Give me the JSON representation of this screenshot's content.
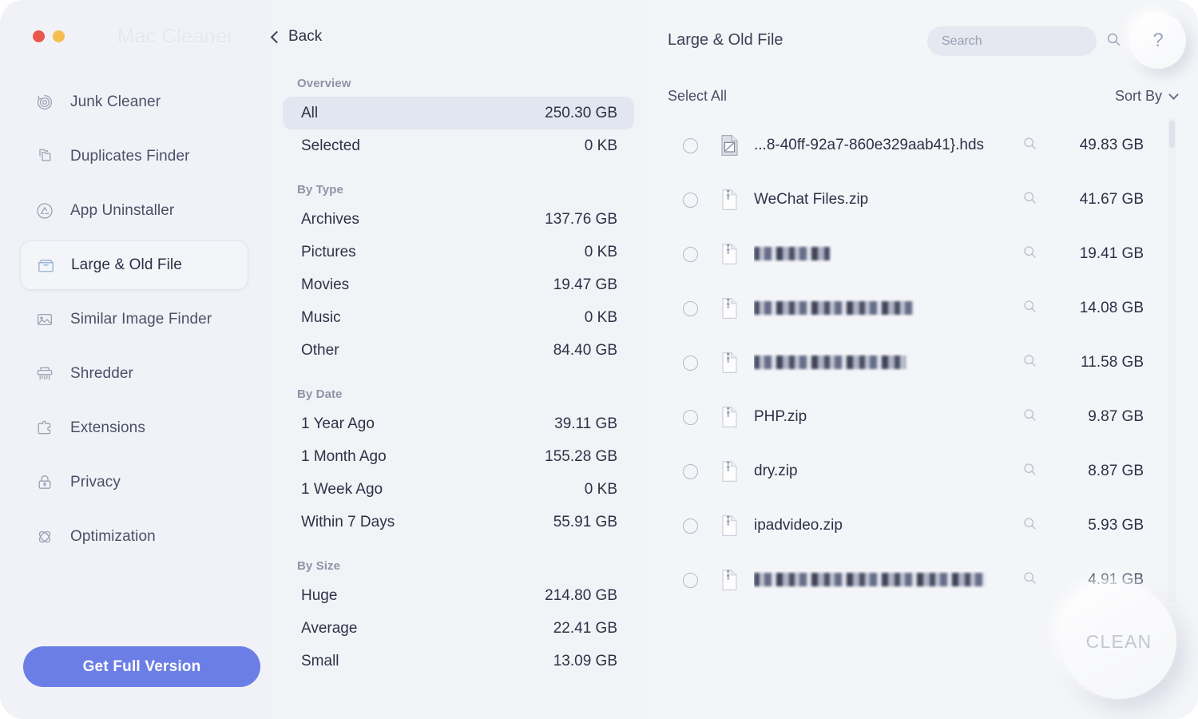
{
  "window": {
    "app_title": "Mac Cleaner",
    "back_label": "Back",
    "traffic_lights": [
      "close-red",
      "minimize-yellow"
    ]
  },
  "sidebar": {
    "items": [
      {
        "label": "Junk Cleaner",
        "icon": "target-refresh-icon",
        "active": false
      },
      {
        "label": "Duplicates Finder",
        "icon": "copy-files-icon",
        "active": false
      },
      {
        "label": "App Uninstaller",
        "icon": "app-store-icon",
        "active": false
      },
      {
        "label": "Large & Old File",
        "icon": "file-box-icon",
        "active": true
      },
      {
        "label": "Similar Image Finder",
        "icon": "photo-icon",
        "active": false
      },
      {
        "label": "Shredder",
        "icon": "shredder-icon",
        "active": false
      },
      {
        "label": "Extensions",
        "icon": "puzzle-piece-icon",
        "active": false
      },
      {
        "label": "Privacy",
        "icon": "lock-icon",
        "active": false
      },
      {
        "label": "Optimization",
        "icon": "atom-icon",
        "active": false
      }
    ],
    "cta_label": "Get Full Version",
    "cta_color": "#6b7ee6"
  },
  "overview": {
    "groups": [
      {
        "title": "Overview",
        "rows": [
          {
            "label": "All",
            "value": "250.30 GB",
            "selected": true
          },
          {
            "label": "Selected",
            "value": "0 KB",
            "selected": false
          }
        ]
      },
      {
        "title": "By Type",
        "rows": [
          {
            "label": "Archives",
            "value": "137.76 GB",
            "selected": false
          },
          {
            "label": "Pictures",
            "value": "0 KB",
            "selected": false
          },
          {
            "label": "Movies",
            "value": "19.47 GB",
            "selected": false
          },
          {
            "label": "Music",
            "value": "0 KB",
            "selected": false
          },
          {
            "label": "Other",
            "value": "84.40 GB",
            "selected": false
          }
        ]
      },
      {
        "title": "By Date",
        "rows": [
          {
            "label": "1 Year Ago",
            "value": "39.11 GB",
            "selected": false
          },
          {
            "label": "1 Month Ago",
            "value": "155.28 GB",
            "selected": false
          },
          {
            "label": "1 Week Ago",
            "value": "0 KB",
            "selected": false
          },
          {
            "label": "Within 7 Days",
            "value": "55.91 GB",
            "selected": false
          }
        ]
      },
      {
        "title": "By Size",
        "rows": [
          {
            "label": "Huge",
            "value": "214.80 GB",
            "selected": false
          },
          {
            "label": "Average",
            "value": "22.41 GB",
            "selected": false
          },
          {
            "label": "Small",
            "value": "13.09 GB",
            "selected": false
          }
        ]
      }
    ]
  },
  "content": {
    "title": "Large & Old File",
    "search_placeholder": "Search",
    "search_value": "",
    "search_icon": "magnifier-icon",
    "help_label": "?",
    "select_all_label": "Select All",
    "sort_by_label": "Sort By",
    "sort_by_icon": "chevron-down-icon",
    "files": [
      {
        "name": "...8-40ff-92a7-860e329aab41}.hds",
        "redacted": false,
        "size": "49.83 GB",
        "icon": "hds-document-icon",
        "checked": false
      },
      {
        "name": "WeChat Files.zip",
        "redacted": false,
        "size": "41.67 GB",
        "icon": "zip-file-icon",
        "checked": false
      },
      {
        "name": "",
        "redacted": true,
        "redact_width": 95,
        "size": "19.41 GB",
        "icon": "zip-file-icon",
        "checked": false
      },
      {
        "name": "",
        "redacted": true,
        "redact_width": 200,
        "size": "14.08 GB",
        "icon": "zip-file-icon",
        "checked": false
      },
      {
        "name": "",
        "redacted": true,
        "redact_width": 190,
        "size": "11.58 GB",
        "icon": "zip-file-icon",
        "checked": false
      },
      {
        "name": "PHP.zip",
        "redacted": false,
        "size": "9.87 GB",
        "icon": "zip-file-icon",
        "checked": false
      },
      {
        "name": "dry.zip",
        "redacted": false,
        "size": "8.87 GB",
        "icon": "zip-file-icon",
        "checked": false
      },
      {
        "name": "ipadvideo.zip",
        "redacted": false,
        "size": "5.93 GB",
        "icon": "zip-file-icon",
        "checked": false
      },
      {
        "name": "",
        "redacted": true,
        "redact_width": 290,
        "size": "4.91 GB",
        "icon": "zip-file-icon",
        "checked": false
      }
    ],
    "clean_label": "CLEAN"
  }
}
